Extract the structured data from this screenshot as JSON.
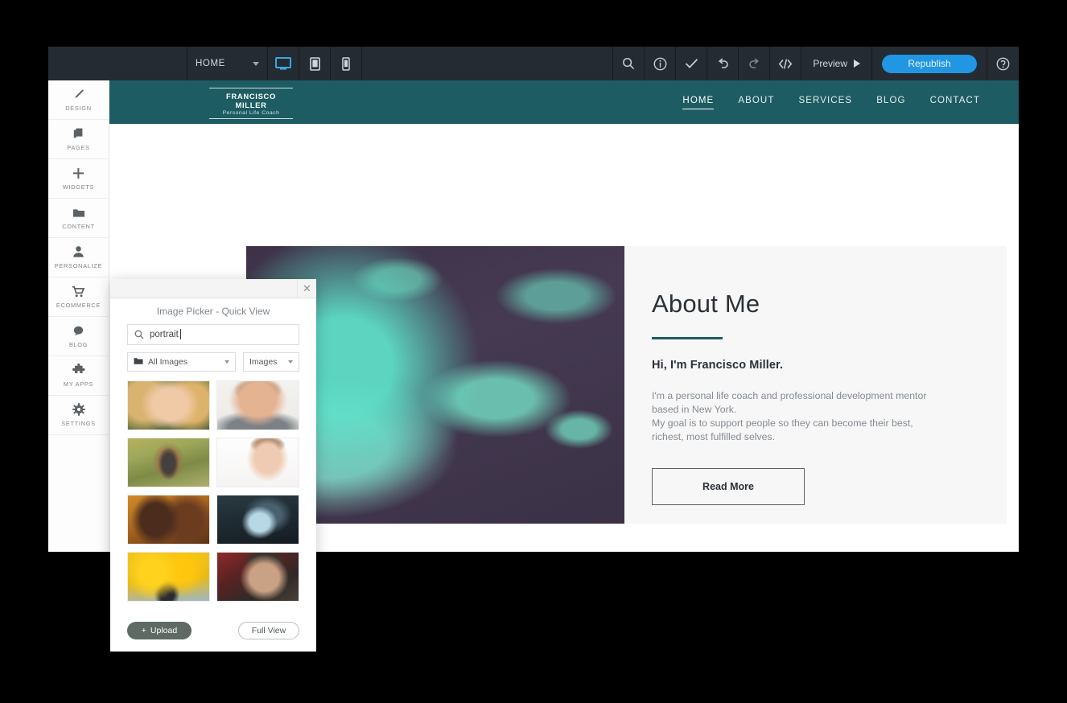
{
  "toolbar": {
    "page_select": {
      "label": "HOME",
      "icon": "chevron-down-icon"
    },
    "devices": [
      {
        "name": "desktop",
        "icon": "desktop-icon",
        "active": true
      },
      {
        "name": "tablet",
        "icon": "tablet-icon",
        "active": false
      },
      {
        "name": "mobile",
        "icon": "mobile-icon",
        "active": false
      }
    ],
    "actions": [
      {
        "name": "search",
        "icon": "search-icon"
      },
      {
        "name": "info",
        "icon": "info-circle-icon"
      },
      {
        "name": "check",
        "icon": "check-icon"
      },
      {
        "name": "undo",
        "icon": "undo-icon"
      },
      {
        "name": "redo",
        "icon": "redo-icon"
      },
      {
        "name": "code",
        "icon": "code-brackets-icon"
      }
    ],
    "preview_label": "Preview",
    "republish_label": "Republish",
    "help_icon": "question-circle-icon",
    "accent_color": "#2196e3",
    "bg_color": "#242b32"
  },
  "sidebar": {
    "items": [
      {
        "label": "DESIGN",
        "icon": "brush-icon"
      },
      {
        "label": "PAGES",
        "icon": "pages-icon"
      },
      {
        "label": "WIDGETS",
        "icon": "plus-icon"
      },
      {
        "label": "CONTENT",
        "icon": "folder-icon"
      },
      {
        "label": "PERSONALIZE",
        "icon": "person-icon"
      },
      {
        "label": "ECOMMERCE",
        "icon": "cart-icon"
      },
      {
        "label": "BLOG",
        "icon": "chat-bubble-icon"
      },
      {
        "label": "MY APPS",
        "icon": "puzzle-piece-icon"
      },
      {
        "label": "SETTINGS",
        "icon": "gear-icon"
      }
    ]
  },
  "site": {
    "header_color": "#1d5c63",
    "logo": {
      "line1": "FRANCISCO MILLER",
      "line2": "Personal Life Coach"
    },
    "nav": [
      {
        "label": "HOME",
        "active": true
      },
      {
        "label": "ABOUT",
        "active": false
      },
      {
        "label": "SERVICES",
        "active": false
      },
      {
        "label": "BLOG",
        "active": false
      },
      {
        "label": "CONTACT",
        "active": false
      }
    ],
    "about": {
      "title": "About Me",
      "subtitle": "Hi, I'm Francisco Miller.",
      "body_line1": "I'm a personal life coach and professional development mentor",
      "body_line2": "based in New York.",
      "body_line3": "My goal is to support people so they can become their best,",
      "body_line4": "richest, most fulfilled selves.",
      "button_label": "Read More",
      "accent_color": "#1d5c63",
      "hero_image_alt": "duotone-portrait-man-with-scarf"
    }
  },
  "picker": {
    "title": "Image Picker - Quick View",
    "close_icon": "close-icon",
    "search": {
      "value": "portrait",
      "icon": "search-icon"
    },
    "folder_select": {
      "label": "All Images",
      "icon": "folder-icon"
    },
    "type_select": {
      "label": "Images"
    },
    "thumbnails": [
      {
        "alt": "blonde-woman-smiling-outdoors"
      },
      {
        "alt": "bearded-man-smiling-gray-shirt"
      },
      {
        "alt": "man-in-autumn-forest"
      },
      {
        "alt": "woman-touching-face-white-background"
      },
      {
        "alt": "dark-skinned-woman-with-earring"
      },
      {
        "alt": "person-underwater-dark"
      },
      {
        "alt": "child-with-yellow-balloons"
      },
      {
        "alt": "older-man-portrait-red-background"
      }
    ],
    "upload_label": "Upload",
    "upload_icon": "plus-icon",
    "fullview_label": "Full View"
  }
}
